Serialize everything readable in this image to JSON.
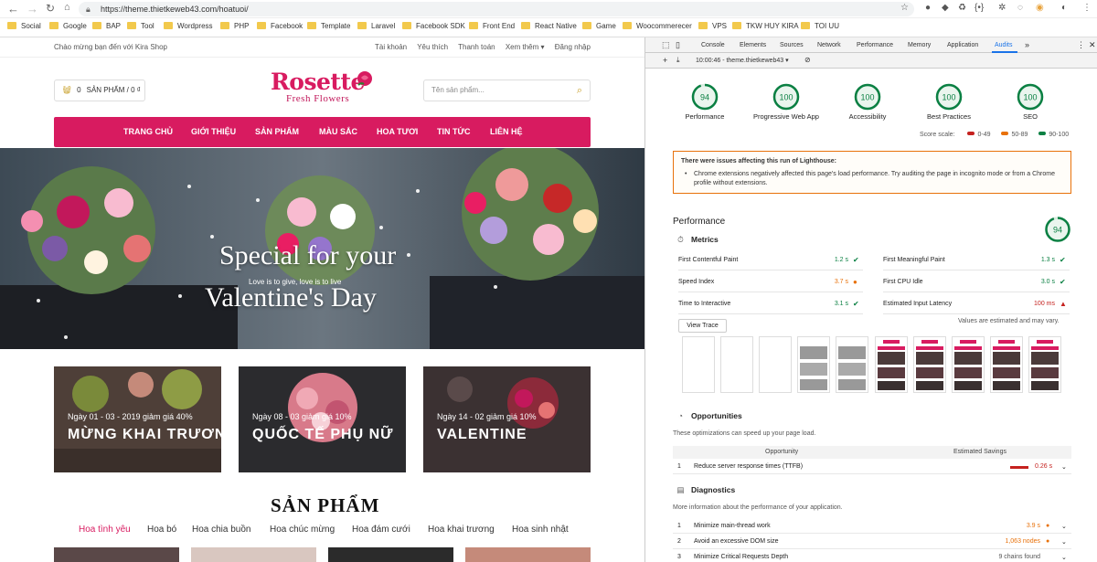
{
  "browser": {
    "url": "https://theme.thietkeweb43.com/hoatuoi/",
    "bookmarks": [
      "Social",
      "Google",
      "BAP",
      "Tool",
      "Wordpress",
      "PHP",
      "Facebook",
      "Template",
      "Laravel",
      "Facebook SDK",
      "Front End",
      "React Native",
      "Game",
      "Woocommerecer",
      "VPS",
      "TKW HUY KIRA",
      "TOI UU"
    ]
  },
  "site": {
    "welcome": "Chào mừng bạn đến với Kira Shop",
    "top_links": [
      "Tài khoản",
      "Yêu thích",
      "Thanh toán",
      "Xem thêm ▾",
      "Đăng nhập"
    ],
    "logo_title": "Rosette",
    "logo_sub": "Fresh Flowers",
    "cart_count": "0",
    "cart_label": "SẢN PHẨM / 0 ₫",
    "search_placeholder": "Tên sản phẩm...",
    "nav": [
      "TRANG CHỦ",
      "GIỚI THIỆU",
      "SẢN PHẨM",
      "MÀU SẮC",
      "HOA TƯƠI",
      "TIN TỨC",
      "LIÊN HỆ"
    ],
    "hero_line1": "Special for your",
    "hero_small": "Love is to give, love is to live",
    "hero_line2": "Valentine's Day",
    "promos": [
      {
        "tag": "Ngày 01 - 03 - 2019 giảm giá 40%",
        "title": "MỪNG KHAI TRƯƠNG"
      },
      {
        "tag": "Ngày 08 - 03 giảm giá 10%",
        "title": "QUỐC TẾ PHỤ NỮ"
      },
      {
        "tag": "Ngày 14 - 02 giảm giá 10%",
        "title": "VALENTINE"
      }
    ],
    "products_title": "SẢN PHẨM",
    "categories": [
      "Hoa tình yêu",
      "Hoa bó",
      "Hoa chia buồn",
      "Hoa chúc mừng",
      "Hoa đám cưới",
      "Hoa khai trương",
      "Hoa sinh nhật"
    ],
    "brand_color": "#d81b60"
  },
  "devtools": {
    "tabs": [
      "Console",
      "Elements",
      "Sources",
      "Network",
      "Performance",
      "Memory",
      "Application",
      "Audits",
      "»"
    ],
    "active_tab": "Audits",
    "toolbar_label": "10:00:46 - theme.thietkeweb43 ▾",
    "scores": [
      {
        "value": "94",
        "label": "Performance"
      },
      {
        "value": "100",
        "label": "Progressive Web App"
      },
      {
        "value": "100",
        "label": "Accessibility"
      },
      {
        "value": "100",
        "label": "Best Practices"
      },
      {
        "value": "100",
        "label": "SEO"
      }
    ],
    "score_scale_label": "Score scale:",
    "scale": [
      "0-49",
      "50-89",
      "90-100"
    ],
    "warning_title": "There were issues affecting this run of Lighthouse:",
    "warning_body": "Chrome extensions negatively affected this page's load performance. Try auditing the page in incognito mode or from a Chrome profile without extensions.",
    "performance_title": "Performance",
    "performance_score": "94",
    "metrics_title": "Metrics",
    "metrics_left": [
      {
        "name": "First Contentful Paint",
        "value": "1.2 s",
        "status": "ok"
      },
      {
        "name": "Speed Index",
        "value": "3.7 s",
        "status": "mid"
      },
      {
        "name": "Time to Interactive",
        "value": "3.1 s",
        "status": "ok"
      }
    ],
    "metrics_right": [
      {
        "name": "First Meaningful Paint",
        "value": "1.3 s",
        "status": "ok"
      },
      {
        "name": "First CPU Idle",
        "value": "3.0 s",
        "status": "ok"
      },
      {
        "name": "Estimated Input Latency",
        "value": "100 ms",
        "status": "bad"
      }
    ],
    "view_trace": "View Trace",
    "estimated_note": "Values are estimated and may vary.",
    "opportunities_title": "Opportunities",
    "opportunities_desc": "These optimizations can speed up your page load.",
    "opp_col1": "Opportunity",
    "opp_col2": "Estimated Savings",
    "opportunities": [
      {
        "idx": "1",
        "name": "Reduce server response times (TTFB)",
        "value": "0.26 s"
      }
    ],
    "diagnostics_title": "Diagnostics",
    "diagnostics_desc": "More information about the performance of your application.",
    "diagnostics": [
      {
        "idx": "1",
        "name": "Minimize main-thread work",
        "value": "3.9 s"
      },
      {
        "idx": "2",
        "name": "Avoid an excessive DOM size",
        "value": "1,063 nodes"
      },
      {
        "idx": "3",
        "name": "Minimize Critical Requests Depth",
        "value": "9 chains found"
      }
    ],
    "colors": {
      "good": "#0b8043",
      "average": "#e8710a",
      "fail": "#c5221f"
    }
  }
}
